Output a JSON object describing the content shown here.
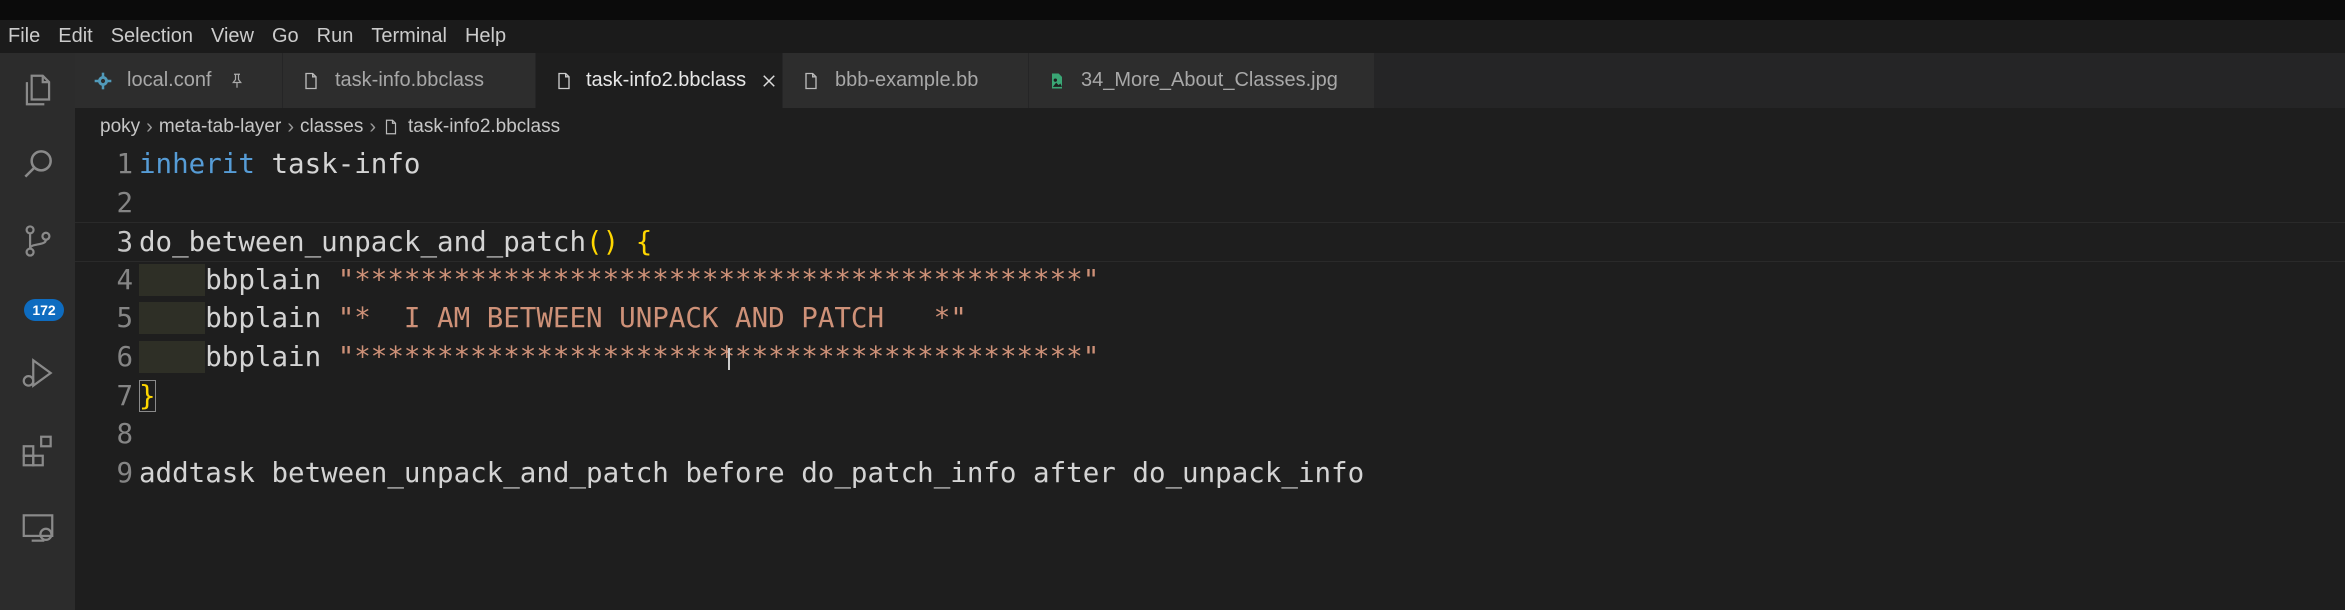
{
  "menubar": {
    "items": [
      "File",
      "Edit",
      "Selection",
      "View",
      "Go",
      "Run",
      "Terminal",
      "Help"
    ]
  },
  "activitybar": {
    "icons": [
      "explorer-icon",
      "search-icon",
      "source-control-icon",
      "run-debug-icon",
      "extensions-icon",
      "remote-explorer-icon"
    ],
    "scm_badge": "172"
  },
  "tabs": [
    {
      "label": "local.conf",
      "icon": "gear-icon",
      "right": "pin-icon",
      "active": false
    },
    {
      "label": "task-info.bbclass",
      "icon": "file-icon",
      "right": "",
      "active": false
    },
    {
      "label": "task-info2.bbclass",
      "icon": "file-icon",
      "right": "close-icon",
      "active": true
    },
    {
      "label": "bbb-example.bb",
      "icon": "file-icon",
      "right": "",
      "active": false
    },
    {
      "label": "34_More_About_Classes.jpg",
      "icon": "image-icon",
      "right": "",
      "active": false
    }
  ],
  "breadcrumb": [
    "poky",
    "meta-tab-layer",
    "classes",
    "task-info2.bbclass"
  ],
  "editor": {
    "lines": [
      {
        "num": "1",
        "tokens": [
          {
            "t": "inherit",
            "c": "kw"
          },
          {
            "t": " task-info",
            "c": "plain"
          }
        ]
      },
      {
        "num": "2",
        "tokens": []
      },
      {
        "num": "3",
        "tokens": [
          {
            "t": "do_between_unpack_and_patch",
            "c": "plain"
          },
          {
            "t": "()",
            "c": "paren"
          },
          {
            "t": " ",
            "c": "plain"
          },
          {
            "t": "{",
            "c": "paren"
          }
        ]
      },
      {
        "num": "4",
        "tokens": [
          {
            "t": "    ",
            "c": "indent"
          },
          {
            "t": "bbplain ",
            "c": "plain"
          },
          {
            "t": "\"********************************************\"",
            "c": "str"
          }
        ]
      },
      {
        "num": "5",
        "tokens": [
          {
            "t": "    ",
            "c": "indent"
          },
          {
            "t": "bbplain ",
            "c": "plain"
          },
          {
            "t": "\"*  I AM BETWEEN UNPACK AND PATCH   *\"",
            "c": "str"
          }
        ]
      },
      {
        "num": "6",
        "tokens": [
          {
            "t": "    ",
            "c": "indent"
          },
          {
            "t": "bbplain ",
            "c": "plain"
          },
          {
            "t": "\"********************************************\"",
            "c": "str"
          }
        ]
      },
      {
        "num": "7",
        "tokens": [
          {
            "t": "}",
            "c": "paren"
          }
        ]
      },
      {
        "num": "8",
        "tokens": []
      },
      {
        "num": "9",
        "tokens": [
          {
            "t": "addtask between_unpack_and_patch before do_patch_info after do_unpack_info",
            "c": "plain"
          }
        ]
      }
    ]
  },
  "colors": {
    "keyword": "#569cd6",
    "string": "#ce9178",
    "bracket": "#ffd700",
    "text": "#d4d4d4",
    "badge": "#0e6cc0"
  }
}
